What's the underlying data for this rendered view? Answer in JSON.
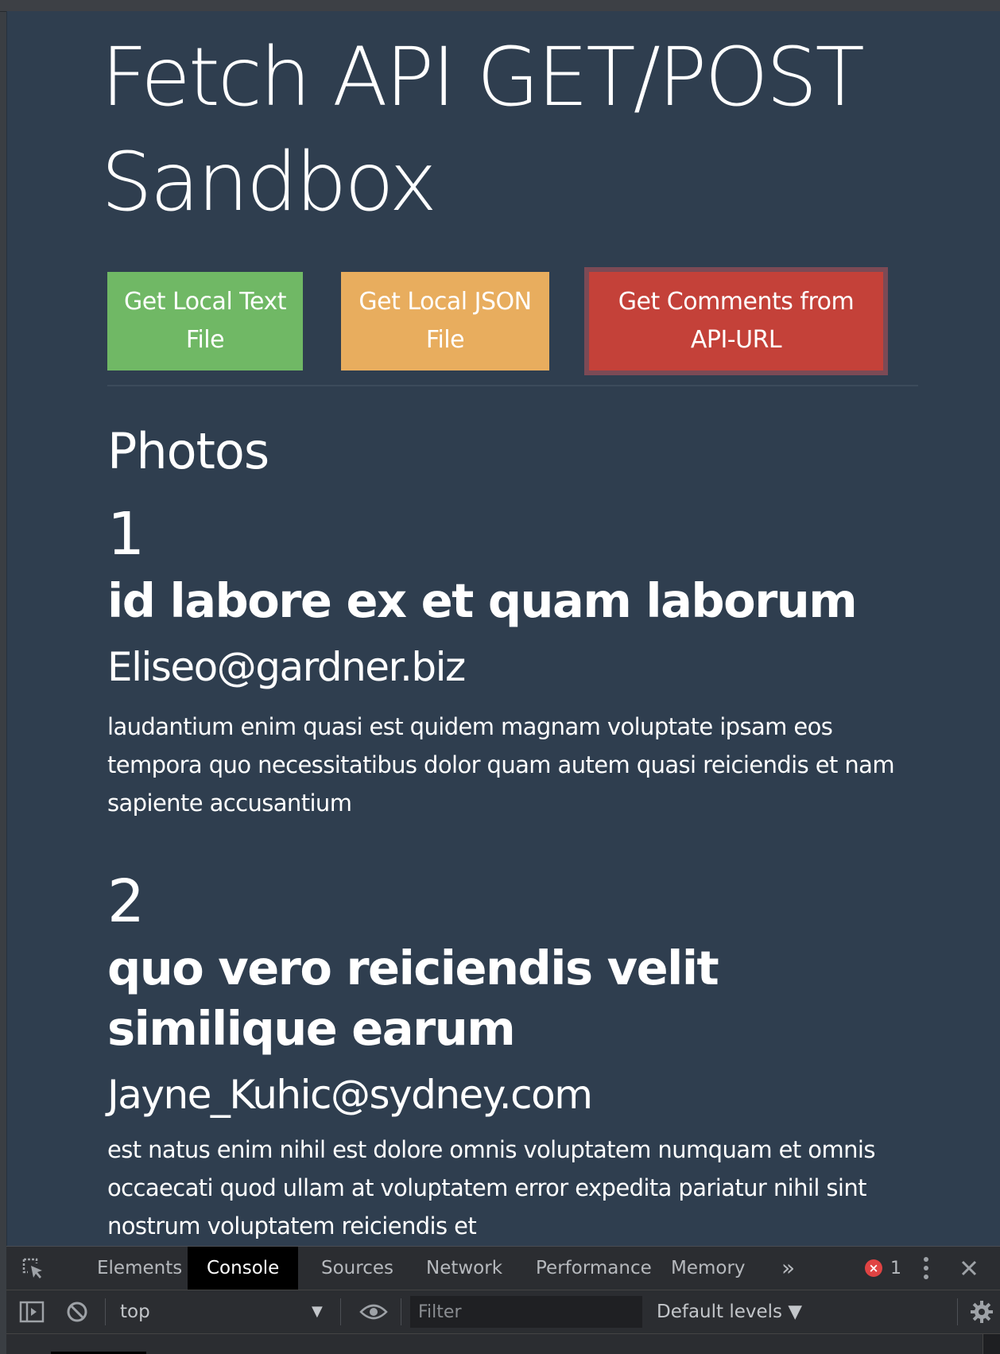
{
  "page": {
    "title": "Fetch API GET/POST Sandbox"
  },
  "buttons": {
    "get_text": "Get Local Text File",
    "get_json": "Get Local JSON File",
    "get_api": "Get Comments from API-URL"
  },
  "output": {
    "heading": "Photos",
    "comments": [
      {
        "id": "1",
        "name": "id labore ex et quam laborum",
        "email": "Eliseo@gardner.biz",
        "body": "laudantium enim quasi est quidem magnam voluptate ipsam eos tempora quo necessitatibus dolor quam autem quasi reiciendis et nam sapiente accusantium"
      },
      {
        "id": "2",
        "name": "quo vero reiciendis velit similique earum",
        "email": "Jayne_Kuhic@sydney.com",
        "body": "est natus enim nihil est dolore omnis voluptatem numquam et omnis occaecati quod ullam at voluptatem error expedita pariatur nihil sint nostrum voluptatem reiciendis et"
      }
    ]
  },
  "devtools": {
    "tabs": [
      "Elements",
      "Console",
      "Sources",
      "Network",
      "Performance",
      "Memory"
    ],
    "active_tab": "Console",
    "more_tabs": "»",
    "error_count": "1",
    "context": "top",
    "context_arrow": "▼",
    "filter_placeholder": "Filter",
    "levels": "Default levels ▼",
    "icons": {
      "inspect": "inspect-element-icon",
      "sidebar": "sidebar-toggle-icon",
      "clear": "clear-console-icon",
      "eye": "live-expression-icon",
      "settings": "gear-icon",
      "menu": "kebab-menu-icon",
      "close": "close-icon"
    }
  },
  "colors": {
    "page_background": "#2f3e4f",
    "button_green": "#70b865",
    "button_orange": "#e8ad5e",
    "button_red": "#c44139",
    "button_focus_border": "#7c4a55",
    "devtools_background": "#2b2d31",
    "error_red": "#e04343"
  }
}
